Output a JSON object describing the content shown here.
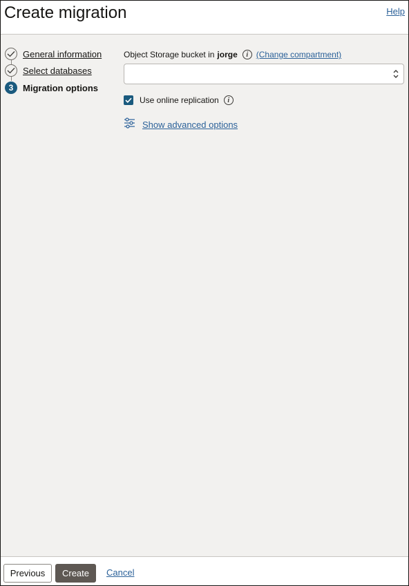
{
  "header": {
    "title": "Create migration",
    "help_label": "Help"
  },
  "steps": [
    {
      "label": "General information",
      "state": "completed"
    },
    {
      "label": "Select databases",
      "state": "completed"
    },
    {
      "label": "Migration options",
      "state": "current",
      "number": "3"
    }
  ],
  "form": {
    "bucket_label": "Object Storage bucket in",
    "bucket_compartment": "jorge",
    "change_compartment": "(Change compartment)",
    "bucket_value": "",
    "online_replication_label": "Use online replication",
    "online_replication_checked": true,
    "advanced_options_label": "Show advanced options"
  },
  "footer": {
    "previous_label": "Previous",
    "create_label": "Create",
    "cancel_label": "Cancel"
  },
  "colors": {
    "accent": "#1a5a7e",
    "link": "#2b6199",
    "primary_button": "#5e5853",
    "panel_background": "#f2f1ef"
  },
  "icons": {
    "completed_step": "check-circle-icon",
    "info": "info-icon",
    "select_arrows": "chevron-up-down-icon",
    "checkbox": "checkmark-icon",
    "advanced": "sliders-icon"
  }
}
